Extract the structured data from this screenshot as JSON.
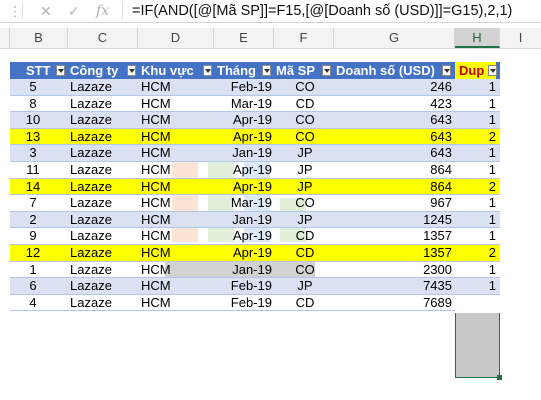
{
  "formula_bar": {
    "cancel_icon": "x-icon",
    "confirm_icon": "check-icon",
    "fx_label": "fx",
    "formula": "=IF(AND([@[Mã SP]]=F15,[@[Doanh số (USD)]]=G15),2,1)"
  },
  "column_headers": [
    "B",
    "C",
    "D",
    "E",
    "F",
    "G",
    "H",
    "I"
  ],
  "table": {
    "headers": {
      "stt": "STT",
      "company": "Công ty",
      "region": "Khu vực",
      "month": "Tháng",
      "product": "Mã SP",
      "sales": "Doanh số (USD)",
      "dup": "Dup"
    },
    "rows": [
      {
        "stt": "5",
        "company": "Lazaze",
        "region": "HCM",
        "month": "Feb-19",
        "product": "CO",
        "sales": "246",
        "dup": "1",
        "hl": false
      },
      {
        "stt": "8",
        "company": "Lazaze",
        "region": "HCM",
        "month": "Mar-19",
        "product": "CD",
        "sales": "423",
        "dup": "1",
        "hl": false
      },
      {
        "stt": "10",
        "company": "Lazaze",
        "region": "HCM",
        "month": "Apr-19",
        "product": "CO",
        "sales": "643",
        "dup": "1",
        "hl": false
      },
      {
        "stt": "13",
        "company": "Lazaze",
        "region": "HCM",
        "month": "Apr-19",
        "product": "CO",
        "sales": "643",
        "dup": "2",
        "hl": true
      },
      {
        "stt": "3",
        "company": "Lazaze",
        "region": "HCM",
        "month": "Jan-19",
        "product": "JP",
        "sales": "643",
        "dup": "1",
        "hl": false
      },
      {
        "stt": "11",
        "company": "Lazaze",
        "region": "HCM",
        "month": "Apr-19",
        "product": "JP",
        "sales": "864",
        "dup": "1",
        "hl": false
      },
      {
        "stt": "14",
        "company": "Lazaze",
        "region": "HCM",
        "month": "Apr-19",
        "product": "JP",
        "sales": "864",
        "dup": "2",
        "hl": true
      },
      {
        "stt": "7",
        "company": "Lazaze",
        "region": "HCM",
        "month": "Mar-19",
        "product": "CO",
        "sales": "967",
        "dup": "1",
        "hl": false
      },
      {
        "stt": "2",
        "company": "Lazaze",
        "region": "HCM",
        "month": "Jan-19",
        "product": "JP",
        "sales": "1245",
        "dup": "1",
        "hl": false
      },
      {
        "stt": "9",
        "company": "Lazaze",
        "region": "HCM",
        "month": "Apr-19",
        "product": "CD",
        "sales": "1357",
        "dup": "1",
        "hl": false
      },
      {
        "stt": "12",
        "company": "Lazaze",
        "region": "HCM",
        "month": "Apr-19",
        "product": "CD",
        "sales": "1357",
        "dup": "2",
        "hl": true
      },
      {
        "stt": "1",
        "company": "Lazaze",
        "region": "HCM",
        "month": "Jan-19",
        "product": "CO",
        "sales": "2300",
        "dup": "1",
        "hl": false
      },
      {
        "stt": "6",
        "company": "Lazaze",
        "region": "HCM",
        "month": "Feb-19",
        "product": "JP",
        "sales": "7435",
        "dup": "1",
        "hl": false
      },
      {
        "stt": "4",
        "company": "Lazaze",
        "region": "HCM",
        "month": "Feb-19",
        "product": "CD",
        "sales": "7689",
        "dup": "1",
        "hl": false
      }
    ]
  },
  "colors": {
    "header_blue": "#4472c4",
    "band_blue": "#d9e1f2",
    "highlight_yellow": "#ffff00",
    "dup_header_text": "#c00000",
    "selection_green": "#217346"
  }
}
